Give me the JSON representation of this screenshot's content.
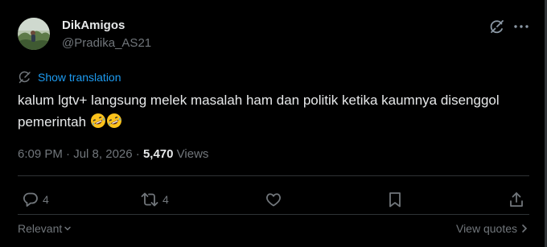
{
  "author": {
    "display_name": "DikAmigos",
    "handle": "@Pradika_AS21"
  },
  "translation": {
    "label": "Show translation"
  },
  "tweet": {
    "text": "kalum lgtv+ langsung melek masalah ham dan politik ketika kaumnya disenggol pemerintah",
    "emojis": [
      "rolling-on-the-floor-laughing",
      "rolling-on-the-floor-laughing"
    ]
  },
  "meta": {
    "time": "6:09 PM",
    "separator": "·",
    "date": "Jul 8, 2026",
    "views_count": "5,470",
    "views_label": "Views"
  },
  "actions": {
    "replies": "4",
    "reposts": "4",
    "likes": "",
    "bookmarks": "",
    "share": ""
  },
  "footer": {
    "sort_label": "Relevant",
    "quotes_label": "View quotes"
  },
  "colors": {
    "background": "#000000",
    "text": "#e7e9ea",
    "secondary": "#71767b",
    "link": "#1d9bf0",
    "divider": "#2f3336"
  }
}
